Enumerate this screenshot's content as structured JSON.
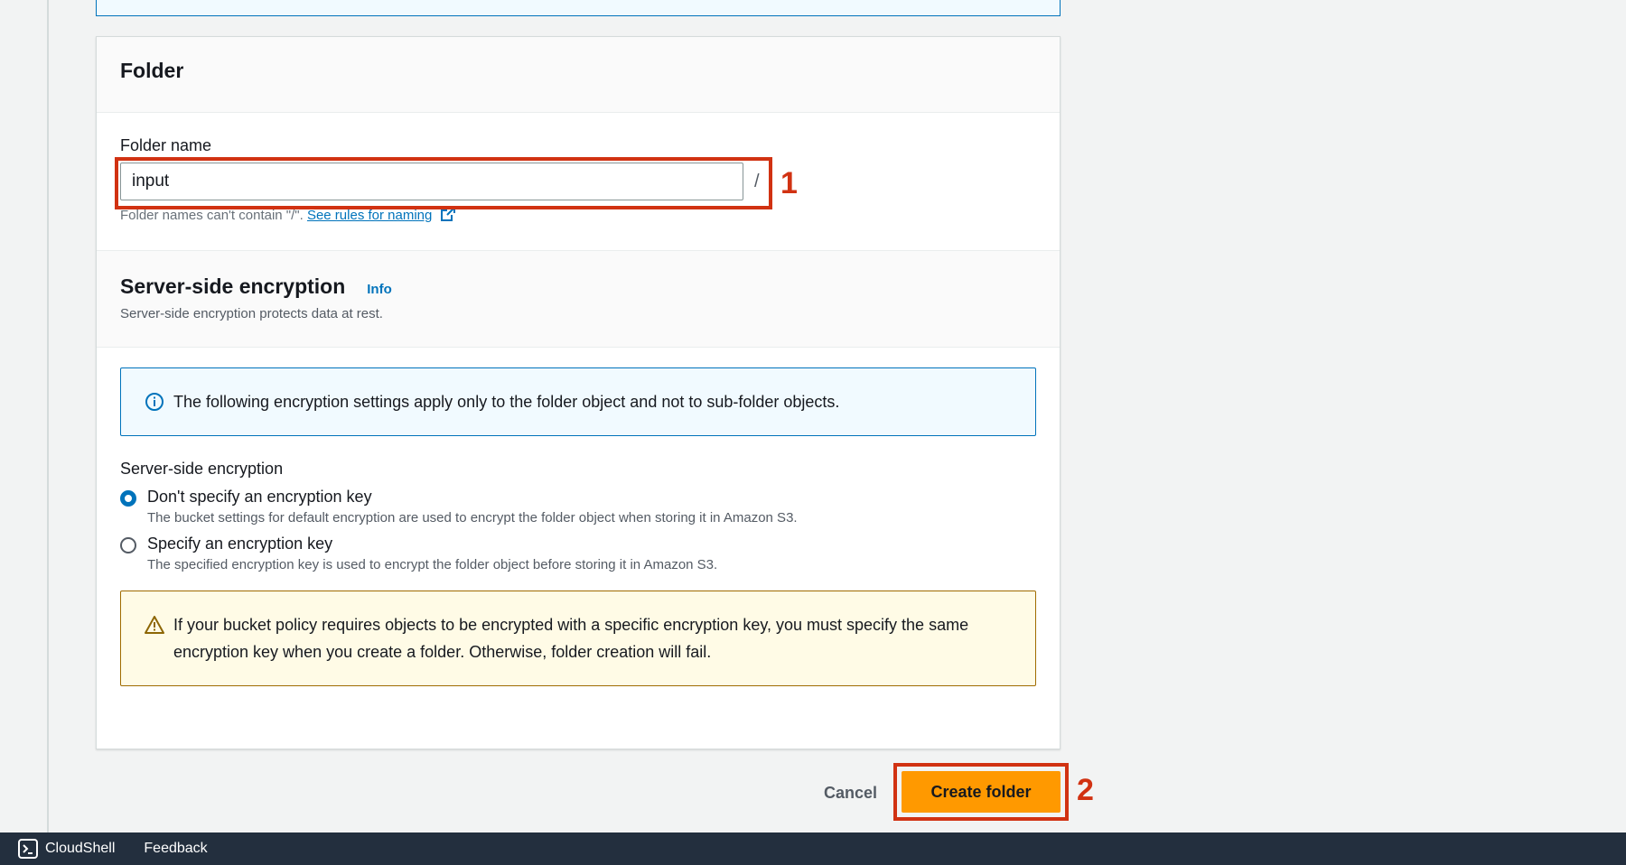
{
  "folder_card": {
    "title": "Folder",
    "name_label": "Folder name",
    "name_value": "input",
    "slash": "/",
    "hint_text": "Folder names can't contain \"/\".",
    "hint_link": "See rules for naming"
  },
  "encryption": {
    "title": "Server-side encryption",
    "info_link": "Info",
    "description": "Server-side encryption protects data at rest.",
    "info_alert": "The following encryption settings apply only to the folder object and not to sub-folder objects.",
    "group_label": "Server-side encryption",
    "options": [
      {
        "label": "Don't specify an encryption key",
        "description": "The bucket settings for default encryption are used to encrypt the folder object when storing it in Amazon S3.",
        "selected": true
      },
      {
        "label": "Specify an encryption key",
        "description": "The specified encryption key is used to encrypt the folder object before storing it in Amazon S3.",
        "selected": false
      }
    ],
    "warning_alert": "If your bucket policy requires objects to be encrypted with a specific encryption key, you must specify the same encryption key when you create a folder. Otherwise, folder creation will fail."
  },
  "actions": {
    "cancel": "Cancel",
    "create": "Create folder"
  },
  "annotations": {
    "step1": "1",
    "step2": "2"
  },
  "bottom_bar": {
    "cloudshell": "CloudShell",
    "feedback": "Feedback"
  },
  "colors": {
    "primary_button": "#ff9900",
    "link": "#0073bb",
    "annotation": "#d13212",
    "bottom_bar": "#232f3e"
  }
}
